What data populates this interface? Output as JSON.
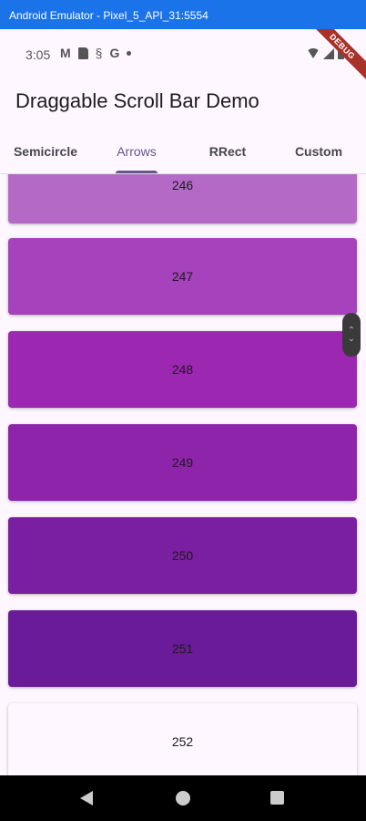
{
  "window": {
    "title": "Android Emulator - Pixel_5_API_31:5554"
  },
  "status_bar": {
    "time": "3:05",
    "left_icons": [
      "gmail-icon",
      "sd-card-icon",
      "s-icon",
      "google-icon",
      "dot-icon"
    ],
    "right_icons": [
      "wifi-icon",
      "signal-icon",
      "battery-icon"
    ],
    "debug_banner": "DEBUG"
  },
  "app_bar": {
    "title": "Draggable Scroll Bar Demo"
  },
  "tabs": [
    {
      "label": "Semicircle"
    },
    {
      "label": "Arrows"
    },
    {
      "label": "RRect"
    },
    {
      "label": "Custom"
    }
  ],
  "active_tab": "Arrows",
  "list": {
    "items": [
      {
        "label": "246",
        "color": "#b569c6"
      },
      {
        "label": "247",
        "color": "#a542bc"
      },
      {
        "label": "248",
        "color": "#9c27b0"
      },
      {
        "label": "249",
        "color": "#8e24aa"
      },
      {
        "label": "250",
        "color": "#7b1fa2"
      },
      {
        "label": "251",
        "color": "#6a1b9a"
      },
      {
        "label": "252",
        "color": "#fef7ff"
      }
    ]
  },
  "scroll_thumb": {
    "up_icon": "chevron-up-icon",
    "down_icon": "chevron-down-icon"
  },
  "nav_bar": {
    "icons": [
      "back-icon",
      "home-icon",
      "recents-icon"
    ]
  },
  "colors": {
    "accent": "#65558f",
    "background": "#fef7ff"
  }
}
